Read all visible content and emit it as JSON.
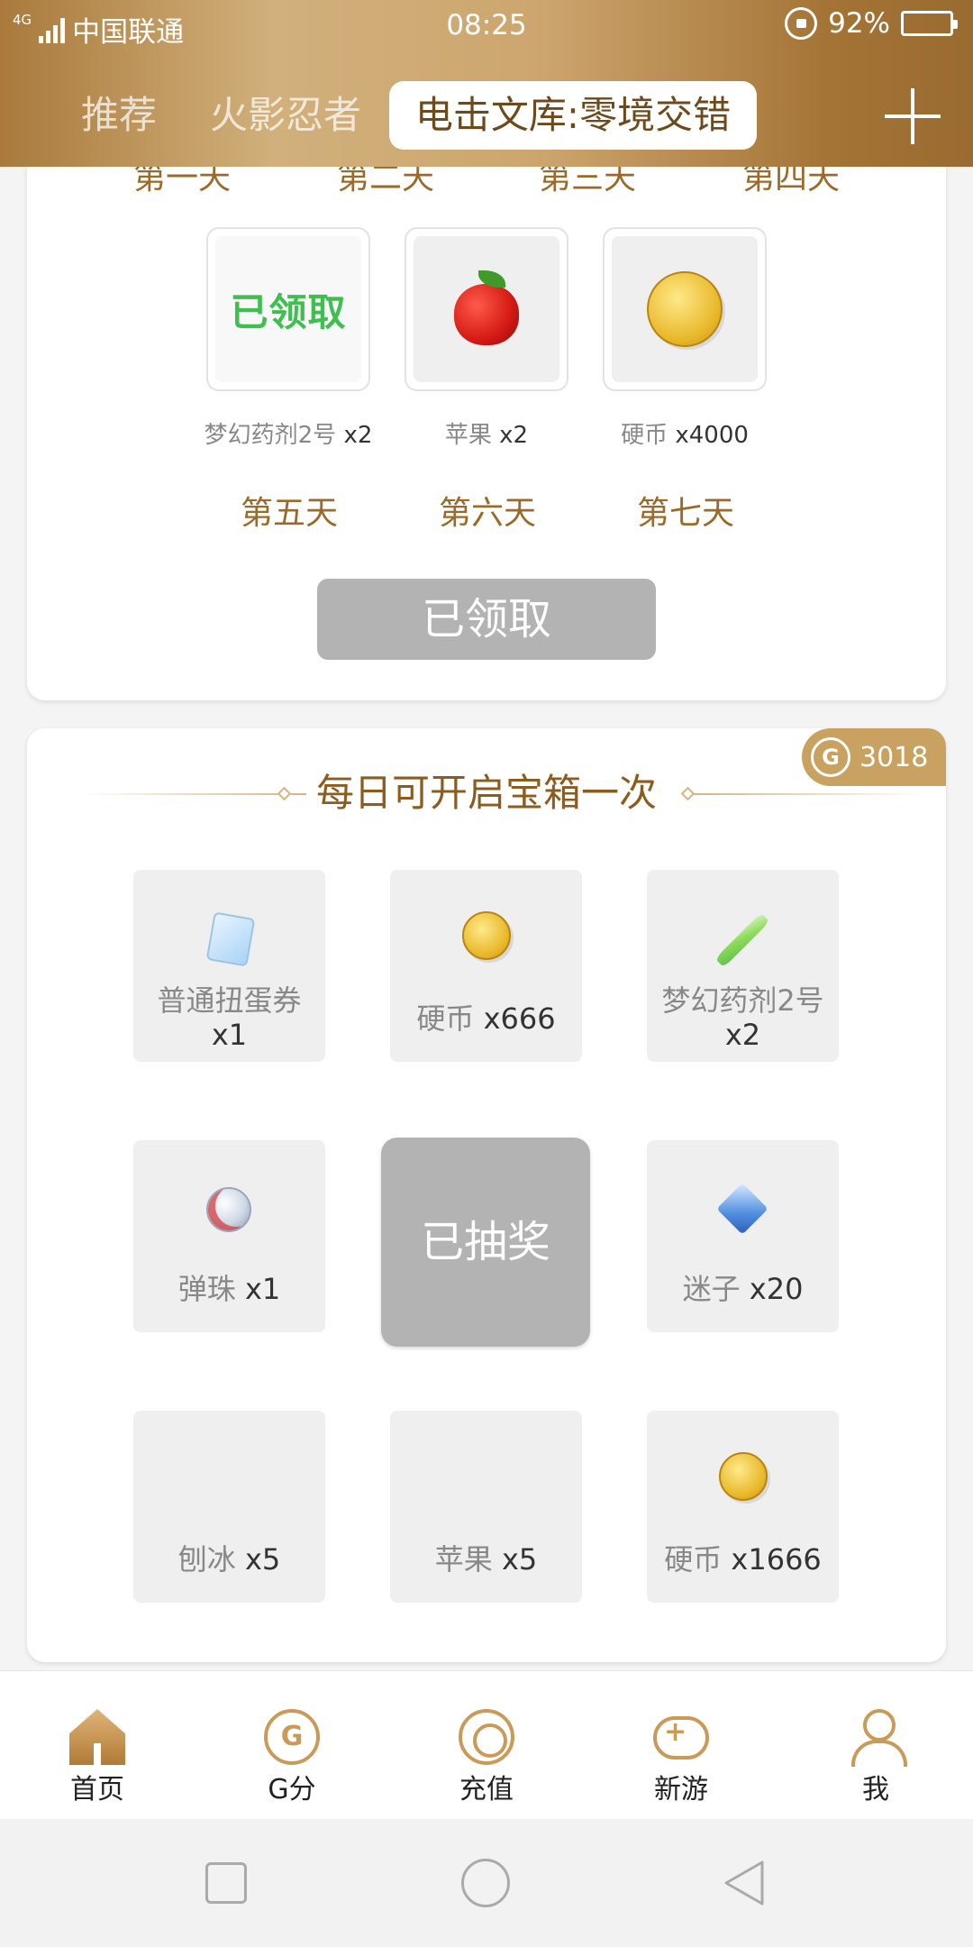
{
  "status_bar": {
    "network": "4G",
    "carrier": "中国联通",
    "time": "08:25",
    "battery_percent": "92%",
    "battery_level": 0.92
  },
  "tabs": [
    {
      "label": "推荐"
    },
    {
      "label": "火影忍者"
    },
    {
      "label": "电击文库:零境交错"
    }
  ],
  "signin": {
    "top_days": [
      "第一天",
      "第二天",
      "第三天",
      "第四天"
    ],
    "rewards": [
      {
        "stamp": "已领取",
        "name": "梦幻药剂2号",
        "qty": "x2",
        "icon": "potion-icon"
      },
      {
        "name": "苹果",
        "qty": "x2",
        "icon": "apple-icon"
      },
      {
        "name": "硬币",
        "qty": "x4000",
        "icon": "coin-icon"
      }
    ],
    "bottom_days": [
      "第五天",
      "第六天",
      "第七天"
    ],
    "button_label": "已领取"
  },
  "chest": {
    "points": "3018",
    "badge_icon_letter": "G",
    "title": "每日可开启宝箱一次",
    "center_label": "已抽奖",
    "items": [
      {
        "name": "普通扭蛋券",
        "qty": "x1",
        "icon": "gacha-ticket-icon"
      },
      {
        "name": "硬币",
        "qty": "x666",
        "icon": "coin-icon"
      },
      {
        "name": "梦幻药剂2号",
        "qty": "x2",
        "icon": "potion-icon"
      },
      {
        "name": "弹珠",
        "qty": "x1",
        "icon": "marble-icon"
      },
      {
        "name": "迷子",
        "qty": "x20",
        "icon": "gem-icon"
      },
      {
        "name": "刨冰",
        "qty": "x5",
        "icon": "shaved-ice-icon"
      },
      {
        "name": "苹果",
        "qty": "x5",
        "icon": "apple-icon"
      },
      {
        "name": "硬币",
        "qty": "x1666",
        "icon": "coin-icon"
      }
    ]
  },
  "bottom_nav": [
    {
      "label": "首页",
      "icon": "home-icon"
    },
    {
      "label": "G分",
      "icon": "g-score-icon",
      "letter": "G"
    },
    {
      "label": "充值",
      "icon": "recharge-icon"
    },
    {
      "label": "新游",
      "icon": "gamepad-icon"
    },
    {
      "label": "我",
      "icon": "profile-icon"
    }
  ],
  "colors": {
    "accent_gold": "#c9a160",
    "title_brown": "#8c5c1e",
    "claimed_gray": "#b3b3b3",
    "stamp_green": "#3fbf4f"
  }
}
